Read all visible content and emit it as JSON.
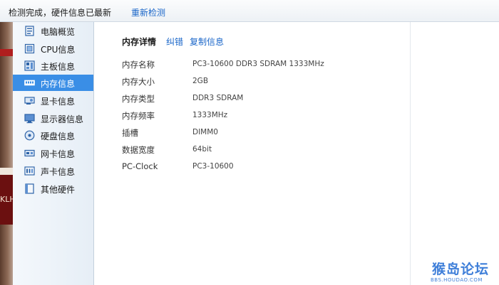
{
  "topbar": {
    "status": "检测完成，硬件信息已最新",
    "rescan": "重新检测"
  },
  "left_edge": {
    "text": "KLH"
  },
  "sidebar": {
    "items": [
      {
        "label": "电脑概览",
        "icon": "computer-icon"
      },
      {
        "label": "CPU信息",
        "icon": "cpu-icon"
      },
      {
        "label": "主板信息",
        "icon": "motherboard-icon"
      },
      {
        "label": "内存信息",
        "icon": "memory-icon",
        "active": true
      },
      {
        "label": "显卡信息",
        "icon": "graphics-card-icon"
      },
      {
        "label": "显示器信息",
        "icon": "monitor-icon"
      },
      {
        "label": "硬盘信息",
        "icon": "hard-disk-icon"
      },
      {
        "label": "网卡信息",
        "icon": "network-card-icon"
      },
      {
        "label": "声卡信息",
        "icon": "sound-card-icon"
      },
      {
        "label": "其他硬件",
        "icon": "other-hardware-icon"
      }
    ]
  },
  "main": {
    "title": "内存详情",
    "links": {
      "correct": "纠错",
      "copy": "复制信息"
    },
    "rows": [
      {
        "label": "内存名称",
        "value": "PC3-10600 DDR3 SDRAM 1333MHz"
      },
      {
        "label": "内存大小",
        "value": "2GB"
      },
      {
        "label": "内存类型",
        "value": "DDR3 SDRAM"
      },
      {
        "label": "内存频率",
        "value": "1333MHz"
      },
      {
        "label": "插槽",
        "value": "DIMM0"
      },
      {
        "label": "数据宽度",
        "value": "64bit"
      },
      {
        "label": "PC-Clock",
        "value": "PC3-10600"
      }
    ]
  },
  "watermark": {
    "text": "猴岛论坛",
    "sub": "BBS.HOUDAO.COM"
  },
  "colors": {
    "active": "#3a8ee6",
    "link": "#1a66c9",
    "watermark": "#3f7fd9"
  }
}
